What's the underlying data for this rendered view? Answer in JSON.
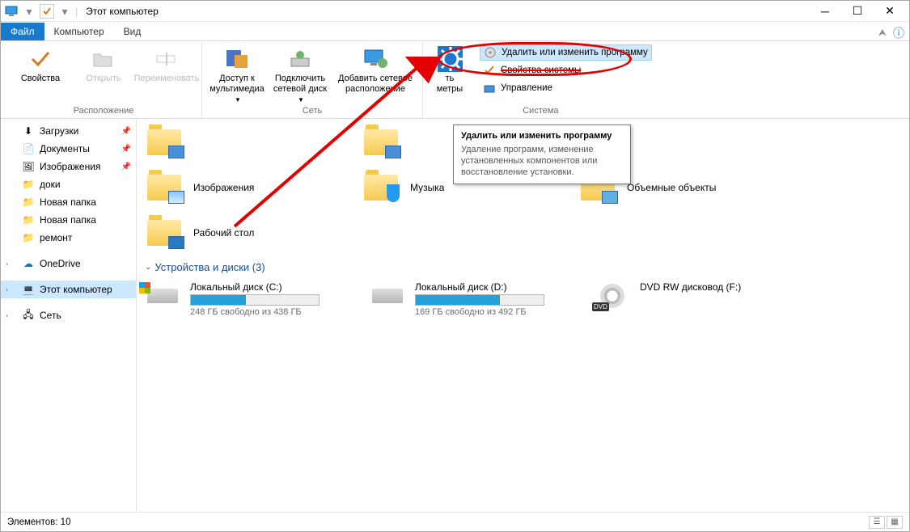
{
  "window": {
    "title": "Этот компьютер"
  },
  "tabs": {
    "file": "Файл",
    "computer": "Компьютер",
    "view": "Вид"
  },
  "ribbon": {
    "group_location": "Расположение",
    "group_network": "Сеть",
    "group_system": "Система",
    "properties": "Свойства",
    "open": "Открыть",
    "rename": "Переименовать",
    "media_access": "Доступ к\nмультимедиа",
    "map_drive": "Подключить\nсетевой диск",
    "add_net_loc": "Добавить сетевое\nрасположение",
    "open_params_short": "ть\nметры",
    "uninstall": "Удалить или изменить программу",
    "sys_props": "Свойства системы",
    "manage": "Управление"
  },
  "tooltip": {
    "title": "Удалить или изменить программу",
    "body": "Удаление программ, изменение установленных компонентов или восстановление установки."
  },
  "nav": {
    "downloads": "Загрузки",
    "documents": "Документы",
    "pictures": "Изображения",
    "doki": "доки",
    "newfolder1": "Новая папка",
    "newfolder2": "Новая папка",
    "remont": "ремонт",
    "onedrive": "OneDrive",
    "thispc": "Этот компьютер",
    "network": "Сеть"
  },
  "folders": {
    "images": "Изображения",
    "music": "Музыка",
    "desktop": "Рабочий стол",
    "objects3d": "Объемные объекты"
  },
  "drives_section": "Устройства и диски (3)",
  "drives": {
    "c": {
      "label": "Локальный диск (C:)",
      "free": "248 ГБ свободно из 438 ГБ",
      "fill": 43
    },
    "d": {
      "label": "Локальный диск (D:)",
      "free": "169 ГБ свободно из 492 ГБ",
      "fill": 66
    },
    "dvd": {
      "label": "DVD RW дисковод (F:)"
    }
  },
  "status": {
    "text": "Элементов: 10"
  }
}
